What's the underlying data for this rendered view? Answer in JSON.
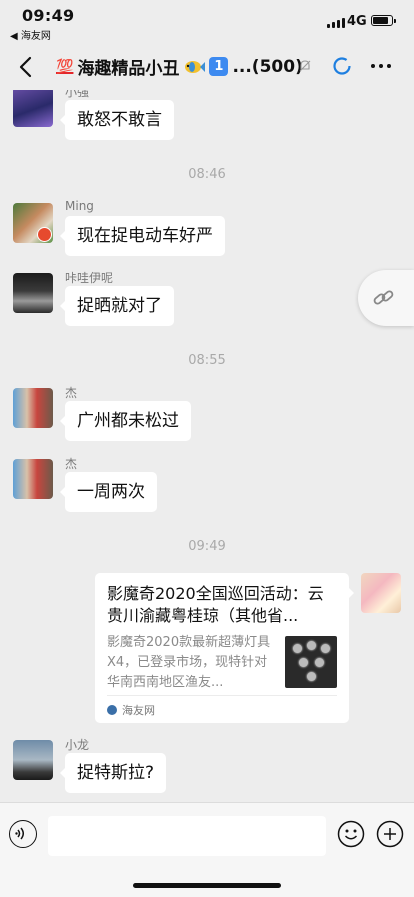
{
  "status_bar": {
    "time": "09:49",
    "back_app": "◀ 海友网",
    "network": "4G",
    "battery_level": 0.85
  },
  "header": {
    "emoji_100": "💯",
    "title": "海趣精品小丑",
    "badge": "1",
    "title_suffix": "...(500)"
  },
  "messages": [
    {
      "sender": "小强",
      "text": "敢怒不敢言"
    },
    {
      "time": "08:46"
    },
    {
      "sender": "Ming",
      "text": "现在捉电动车好严"
    },
    {
      "sender": "咔哇伊呢",
      "text": "捉晒就对了"
    },
    {
      "time": "08:55"
    },
    {
      "sender": "杰",
      "text": "广州都未松过"
    },
    {
      "sender": "杰",
      "text": "一周两次"
    },
    {
      "time": "09:49"
    },
    {
      "sender": "小龙",
      "text": "捉特斯拉?"
    }
  ],
  "link_card": {
    "title": "影魔奇2020全国巡回活动：云贵川渝藏粤桂琼（其他省...",
    "description": "影魔奇2020款最新超薄灯具X4，已登录市场，现特针对华南西南地区渔友...",
    "source": "海友网"
  },
  "input": {
    "placeholder": ""
  },
  "icons": {
    "back": "chevron-left-icon",
    "mute": "bell-slash-icon",
    "more": "more-dots-icon",
    "link": "link-icon",
    "voice": "voice-icon",
    "emoji": "emoji-icon",
    "plus": "plus-icon"
  }
}
